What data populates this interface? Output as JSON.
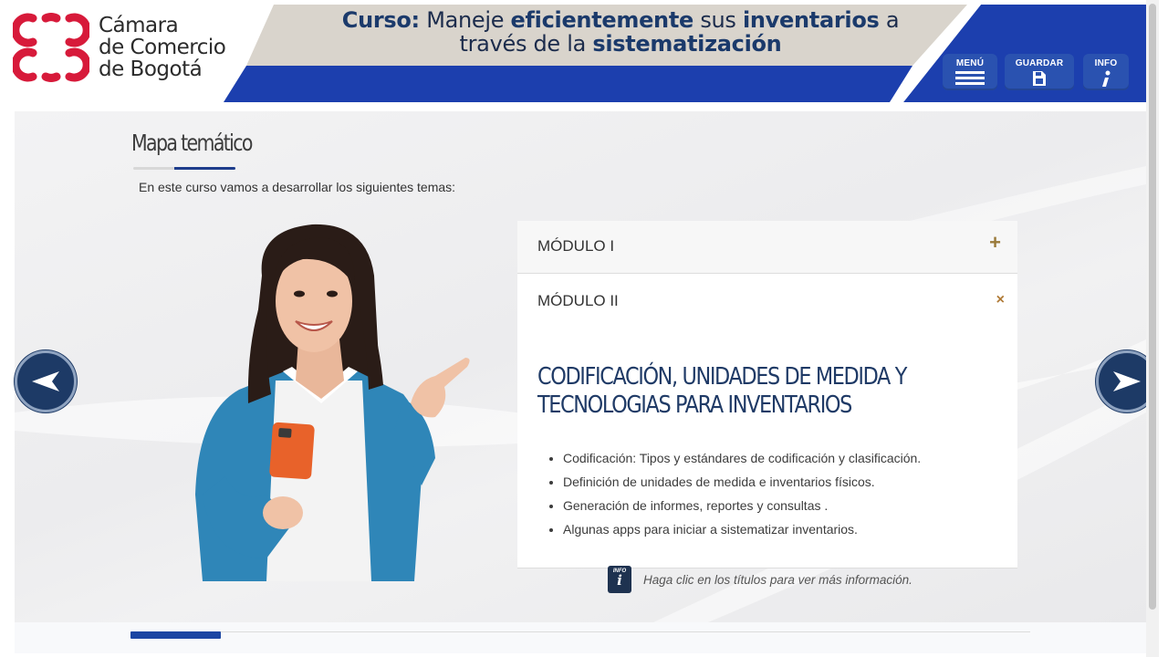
{
  "header": {
    "logo_lines": [
      "Cámara",
      "de Comercio",
      "de Bogotá"
    ],
    "course_title": {
      "line1_prefix": "Curso:",
      "line1_a": " Maneje ",
      "line1_b": "eficientemente",
      "line1_c": " sus ",
      "line1_d": "inventarios",
      "line1_e": " a",
      "line2_a": "través de la ",
      "line2_b": "sistematización"
    },
    "buttons": {
      "menu": "MENÚ",
      "save": "GUARDAR",
      "info": "INFO"
    },
    "colors": {
      "brand_blue": "#1c3fae",
      "logo_red": "#d71a3a",
      "banner_beige": "#d9d4cc"
    }
  },
  "page": {
    "title": "Mapa temático",
    "intro": "En este curso vamos a desarrollar los siguientes temas:",
    "accordion": [
      {
        "label": "MÓDULO I",
        "toggle": "+",
        "open": false
      },
      {
        "label": "MÓDULO II",
        "toggle": "×",
        "open": true,
        "content_title": "CODIFICACIÓN, UNIDADES DE MEDIDA Y TECNOLOGIAS PARA INVENTARIOS",
        "topics": [
          "Codificación: Tipos y estándares de codificación y clasificación.",
          "Definición de unidades de medida e inventarios físicos.",
          "Generación de informes, reportes y consultas .",
          "Algunas apps para iniciar a sistematizar inventarios."
        ]
      }
    ],
    "hint": {
      "icon_label": "INFO",
      "icon_glyph": "i",
      "text": "Haga clic en los títulos para ver más información."
    }
  },
  "navigation": {
    "prev_icon": "arrow-left-icon",
    "next_icon": "arrow-right-icon",
    "progress_fraction": 0.1
  }
}
